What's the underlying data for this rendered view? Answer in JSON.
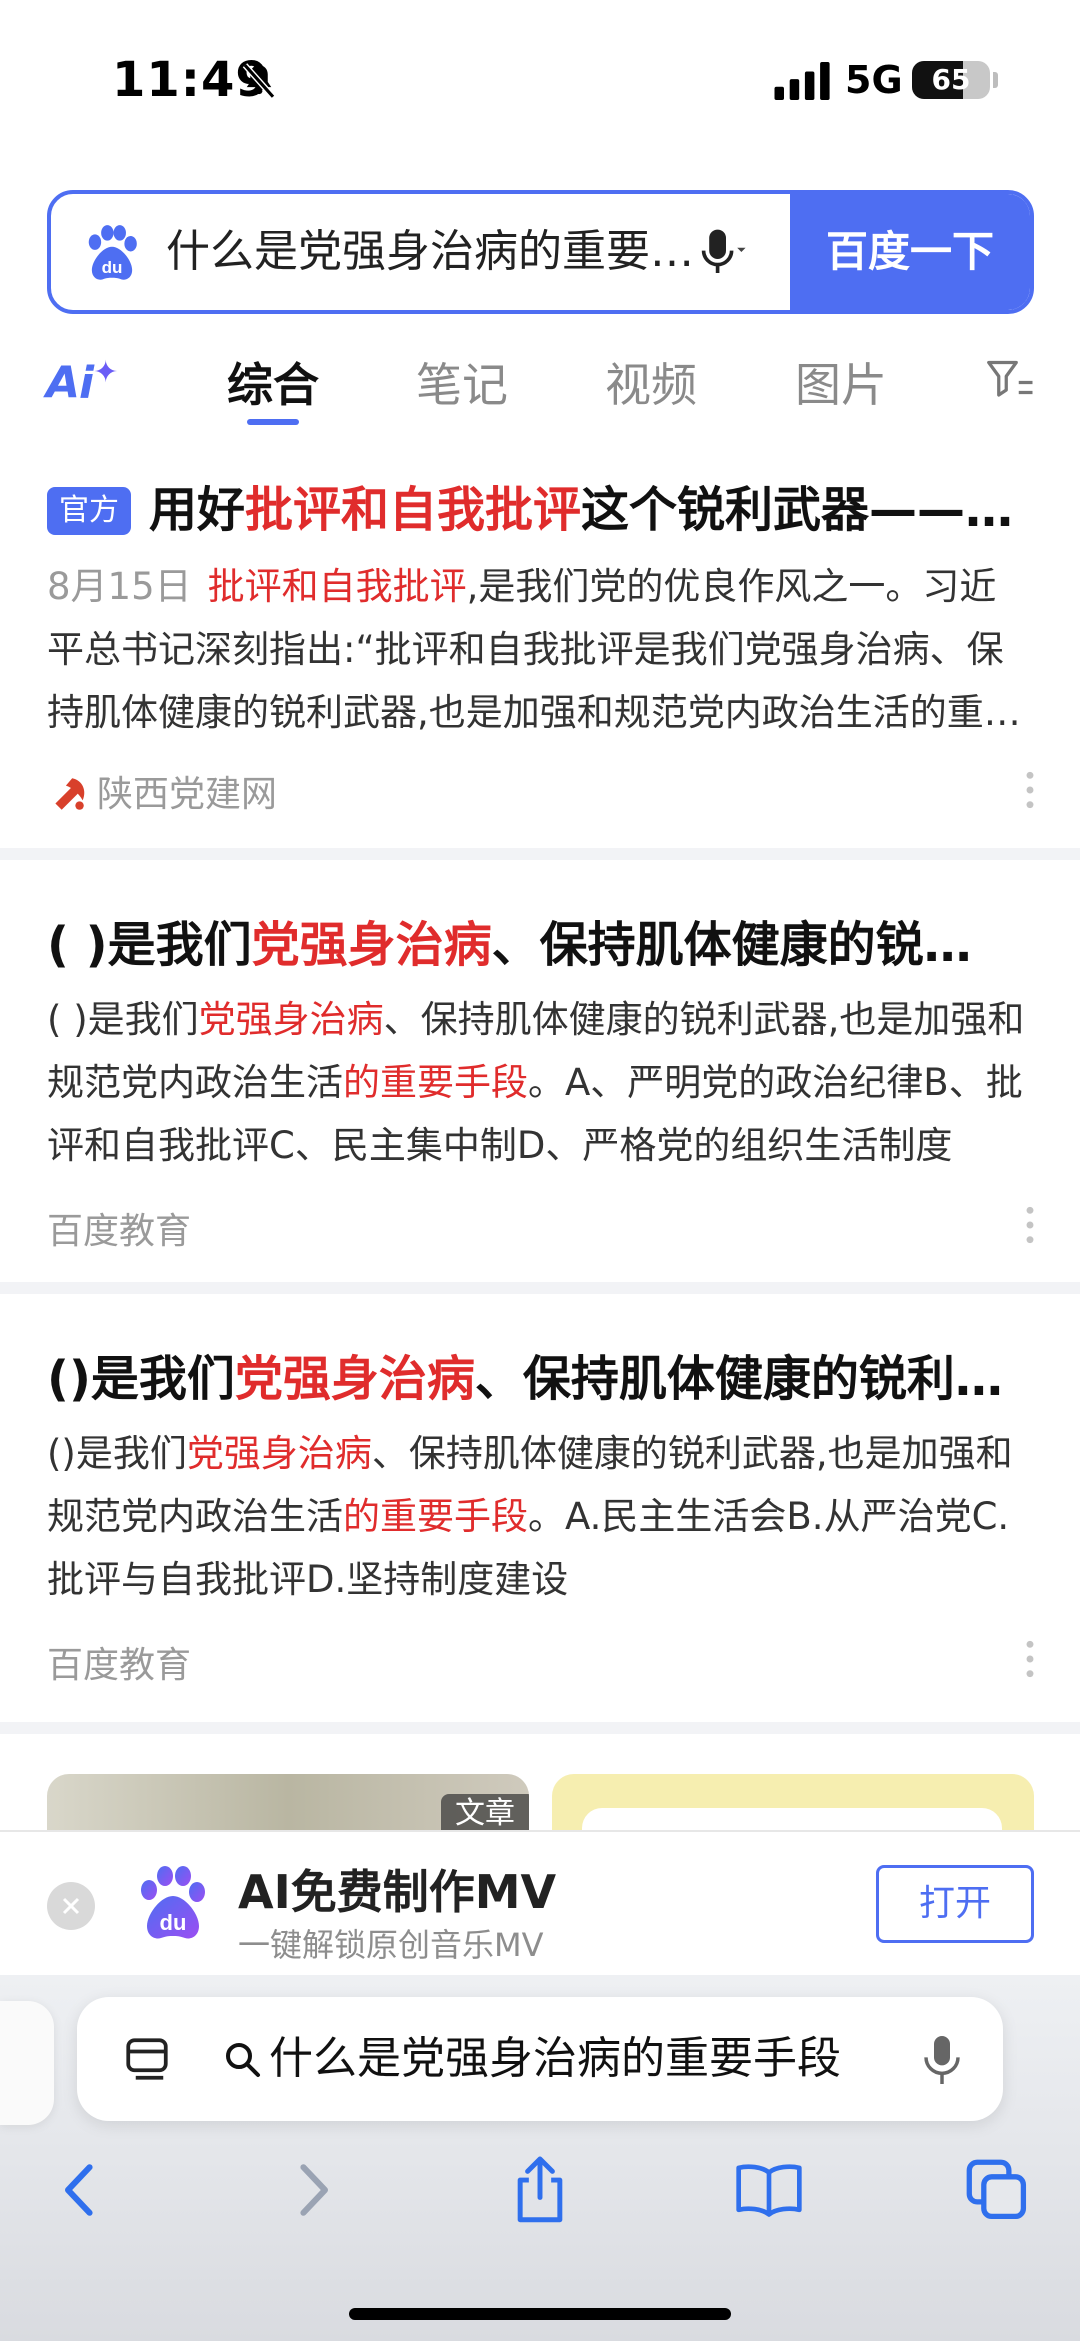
{
  "status_bar": {
    "time": "11:49",
    "network": "5G",
    "battery": "65",
    "battery_level": 0.65
  },
  "search": {
    "query": "什么是党强身治病的重要手段",
    "button_label": "百度一下"
  },
  "tabs": {
    "ai_label": "Ai",
    "items": [
      "综合",
      "笔记",
      "视频",
      "图片"
    ],
    "active": "综合"
  },
  "results": [
    {
      "badge": "官方",
      "title_parts": [
        {
          "text": "用好",
          "hl": false
        },
        {
          "text": "批评和自我批评",
          "hl": true
        },
        {
          "text": "这个锐利武器——以党的自我革命引领社会革命",
          "hl": false
        }
      ],
      "date": "8月15日",
      "body_parts": [
        {
          "text": "批评和自我批评",
          "hl": true
        },
        {
          "text": ",是我们党的优良作风之一。习近平总书记深刻指出:“批评和自我批评是我们党强身治病、保持肌体健康的锐利武器,也是加强和规范党内政治生活的重要手段”",
          "hl": false
        }
      ],
      "source": "陕西党建网"
    },
    {
      "title_parts": [
        {
          "text": "( )是我们",
          "hl": false
        },
        {
          "text": "党强身治病",
          "hl": true
        },
        {
          "text": "、保持肌体健康的锐利武器,也是加强和规范党内政治生活的重要手段",
          "hl": false
        }
      ],
      "body_parts": [
        {
          "text": "( )是我们",
          "hl": false
        },
        {
          "text": "党强身治病",
          "hl": true
        },
        {
          "text": "、保持肌体健康的锐利武器,也是加强和规范党内政治生活",
          "hl": false
        },
        {
          "text": "的重要手段",
          "hl": true
        },
        {
          "text": "。A、严明党的政治纪律B、批评和自我批评C、民主集中制D、严格党的组织生活制度",
          "hl": false
        }
      ],
      "source": "百度教育"
    },
    {
      "title_parts": [
        {
          "text": "()是我们",
          "hl": false
        },
        {
          "text": "党强身治病",
          "hl": true
        },
        {
          "text": "、保持肌体健康的锐利武器,也是加强和规范党内政治生活的重要手段",
          "hl": false
        }
      ],
      "body_parts": [
        {
          "text": "()是我们",
          "hl": false
        },
        {
          "text": "党强身治病",
          "hl": true
        },
        {
          "text": "、保持肌体健康的锐利武器,也是加强和规范党内政治生活",
          "hl": false
        },
        {
          "text": "的重要手段",
          "hl": true
        },
        {
          "text": "。A.民主生活会B.从严治党C.批评与自我批评D.坚持制度建设",
          "hl": false
        }
      ],
      "source": "百度教育"
    }
  ],
  "cards": {
    "left_tag": "文章"
  },
  "app_banner": {
    "name": "AI免费制作MV",
    "subtitle": "一键解锁原创音乐MV",
    "open_label": "打开"
  },
  "browser": {
    "address_text": "什么是党强身治病的重要手段"
  },
  "colors": {
    "accent": "#4e6ef2",
    "highlight": "#e02c2c"
  }
}
